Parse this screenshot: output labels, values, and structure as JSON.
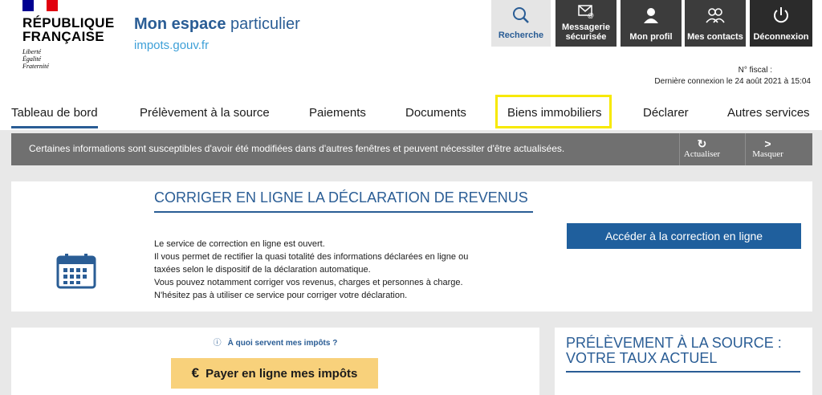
{
  "brand": {
    "rf_name": "RÉPUBLIQUE FRANÇAISE",
    "motto": [
      "Liberté",
      "Égalité",
      "Fraternité"
    ],
    "flag_colors": [
      "#000091",
      "#ffffff",
      "#e1000f"
    ]
  },
  "header": {
    "title_bold": "Mon espace",
    "title_rest": "particulier",
    "subtitle": "impots.gouv.fr"
  },
  "toolbar": {
    "search_label": "Recherche",
    "messaging_label": "Messagerie sécurisée",
    "profile_label": "Mon profil",
    "contacts_label": "Mes contacts",
    "logout_label": "Déconnexion"
  },
  "account": {
    "fiscal_number": "N° fiscal :",
    "last_connection": "Dernière connexion le 24 août 2021 à 15:04"
  },
  "nav": {
    "items": [
      {
        "label": "Tableau de bord",
        "active": true
      },
      {
        "label": "Prélèvement à la source"
      },
      {
        "label": "Paiements"
      },
      {
        "label": "Documents"
      },
      {
        "label": "Biens immobiliers",
        "highlighted": true
      },
      {
        "label": "Déclarer"
      },
      {
        "label": "Autres services"
      }
    ]
  },
  "alert": {
    "text": "Certaines informations sont susceptibles d'avoir été modifiées dans d'autres fenêtres et peuvent nécessiter d'être actualisées.",
    "refresh_label": "Actualiser",
    "hide_label": "Masquer"
  },
  "correction_card": {
    "title": "CORRIGER EN LIGNE LA DÉCLARATION DE REVENUS",
    "lines": [
      "Le service de correction en ligne est ouvert.",
      "Il vous permet de rectifier la quasi totalité des informations déclarées en ligne ou",
      "taxées selon le dispositif de la déclaration automatique.",
      "Vous pouvez notamment corriger vos revenus, charges et personnes à charge.",
      "N'hésitez pas à utiliser ce service pour corriger votre déclaration."
    ],
    "button_label": "Accéder à la correction en ligne"
  },
  "payment_card": {
    "why_link": "À quoi servent mes impôts ?",
    "pay_button": "Payer en ligne mes impôts"
  },
  "pas_card": {
    "title": "PRÉLÈVEMENT À LA SOURCE : VOTRE TAUX ACTUEL"
  },
  "colors": {
    "accent": "#2a5d95",
    "highlight": "#f7e900",
    "pay_button": "#f8d17b"
  }
}
